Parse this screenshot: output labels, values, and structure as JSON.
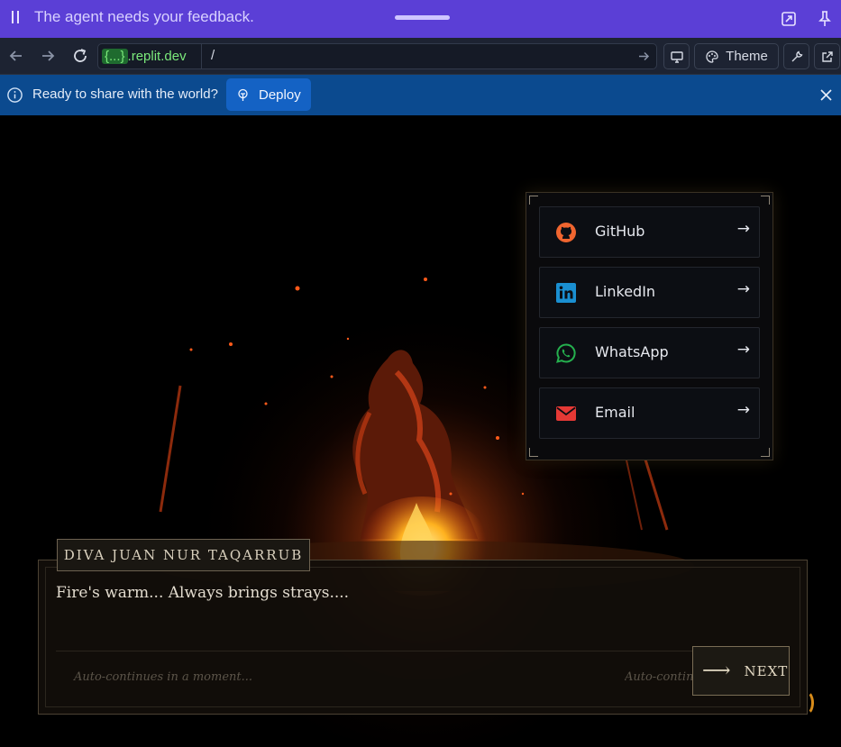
{
  "agent_bar": {
    "message": "The agent needs your feedback.",
    "icons": [
      "pause-icon",
      "grab-handle",
      "collapse-icon",
      "pin-icon"
    ]
  },
  "browser_bar": {
    "url_host_prefix": "{...}",
    "url_host_domain": ".replit.dev",
    "url_path": "/",
    "theme_label": "Theme",
    "icons": [
      "back-icon",
      "forward-icon",
      "reload-icon",
      "go-icon",
      "device-icon",
      "palette-icon",
      "wrench-icon",
      "external-link-icon"
    ]
  },
  "deploy_banner": {
    "text": "Ready to share with the world?",
    "button_label": "Deploy",
    "icons": [
      "info-icon",
      "deploy-icon",
      "close-icon"
    ]
  },
  "links": [
    {
      "label": "GitHub",
      "arrow": "→",
      "icon": "github-icon",
      "color": "#f0652f"
    },
    {
      "label": "LinkedIn",
      "arrow": "→",
      "icon": "linkedin-icon",
      "color": "#1a8fd1"
    },
    {
      "label": "WhatsApp",
      "arrow": "→",
      "icon": "whatsapp-icon",
      "color": "#25b04e"
    },
    {
      "label": "Email",
      "arrow": "→",
      "icon": "email-icon",
      "color": "#e53935"
    }
  ],
  "dialogue": {
    "speaker": "DIVA JUAN NUR TAQARRUB",
    "line": "Fire's warm... Always brings strays....",
    "auto_hint_left": "Auto-continues in a moment...",
    "auto_hint_right": "Auto-continues in a moment...",
    "next_arrow": "⟶",
    "next_label": "NEXT"
  },
  "colors": {
    "agent_bar": "#5b3fd6",
    "browser_bar": "#1d2332",
    "deploy_banner": "#0b4a8f",
    "deploy_button": "#1462c4",
    "url_host": "#7bea7b",
    "fire": "#e8561a",
    "spinner": "#d88c1a"
  }
}
